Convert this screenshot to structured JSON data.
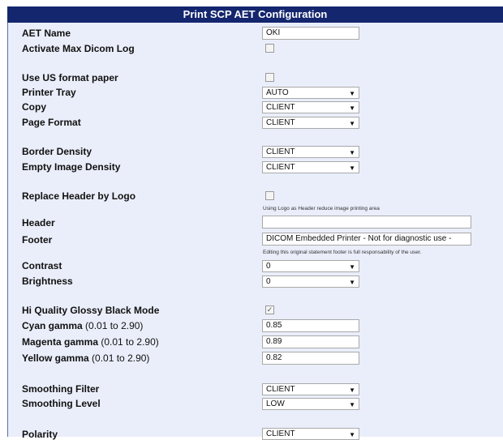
{
  "title": "Print SCP AET Configuration",
  "fields": {
    "aet_name": {
      "label": "AET Name",
      "value": "OKI"
    },
    "activate_max_dicom_log": {
      "label": "Activate Max Dicom Log",
      "checked": false
    },
    "use_us_format_paper": {
      "label": "Use US format paper",
      "checked": false
    },
    "printer_tray": {
      "label": "Printer Tray",
      "value": "AUTO"
    },
    "copy": {
      "label": "Copy",
      "value": "CLIENT"
    },
    "page_format": {
      "label": "Page Format",
      "value": "CLIENT"
    },
    "border_density": {
      "label": "Border Density",
      "value": "CLIENT"
    },
    "empty_image_density": {
      "label": "Empty Image Density",
      "value": "CLIENT"
    },
    "replace_header_by_logo": {
      "label": "Replace Header by Logo",
      "checked": false,
      "hint": "Using Logo as Header reduce image printing area"
    },
    "header": {
      "label": "Header",
      "value": ""
    },
    "footer": {
      "label": "Footer",
      "value": "DICOM Embedded Printer  -  Not for diagnostic use  -",
      "hint": "Editing this original statement footer is full responsability of the user."
    },
    "contrast": {
      "label": "Contrast",
      "value": "0"
    },
    "brightness": {
      "label": "Brightness",
      "value": "0"
    },
    "hi_quality_glossy_black_mode": {
      "label": "Hi Quality Glossy Black Mode",
      "checked": true
    },
    "cyan_gamma": {
      "label": "Cyan gamma",
      "range": " (0.01 to 2.90)",
      "value": "0.85"
    },
    "magenta_gamma": {
      "label": "Magenta gamma",
      "range": " (0.01 to 2.90)",
      "value": "0.89"
    },
    "yellow_gamma": {
      "label": "Yellow gamma",
      "range": " (0.01 to 2.90)",
      "value": "0.82"
    },
    "smoothing_filter": {
      "label": "Smoothing Filter",
      "value": "CLIENT"
    },
    "smoothing_level": {
      "label": "Smoothing Level",
      "value": "LOW"
    },
    "polarity": {
      "label": "Polarity",
      "value": "CLIENT"
    }
  },
  "icons": {
    "dropdown": "chevron-down-icon",
    "check": "check-icon"
  },
  "colors": {
    "title_bg": "#14266e",
    "panel_bg": "#eaeefa"
  }
}
